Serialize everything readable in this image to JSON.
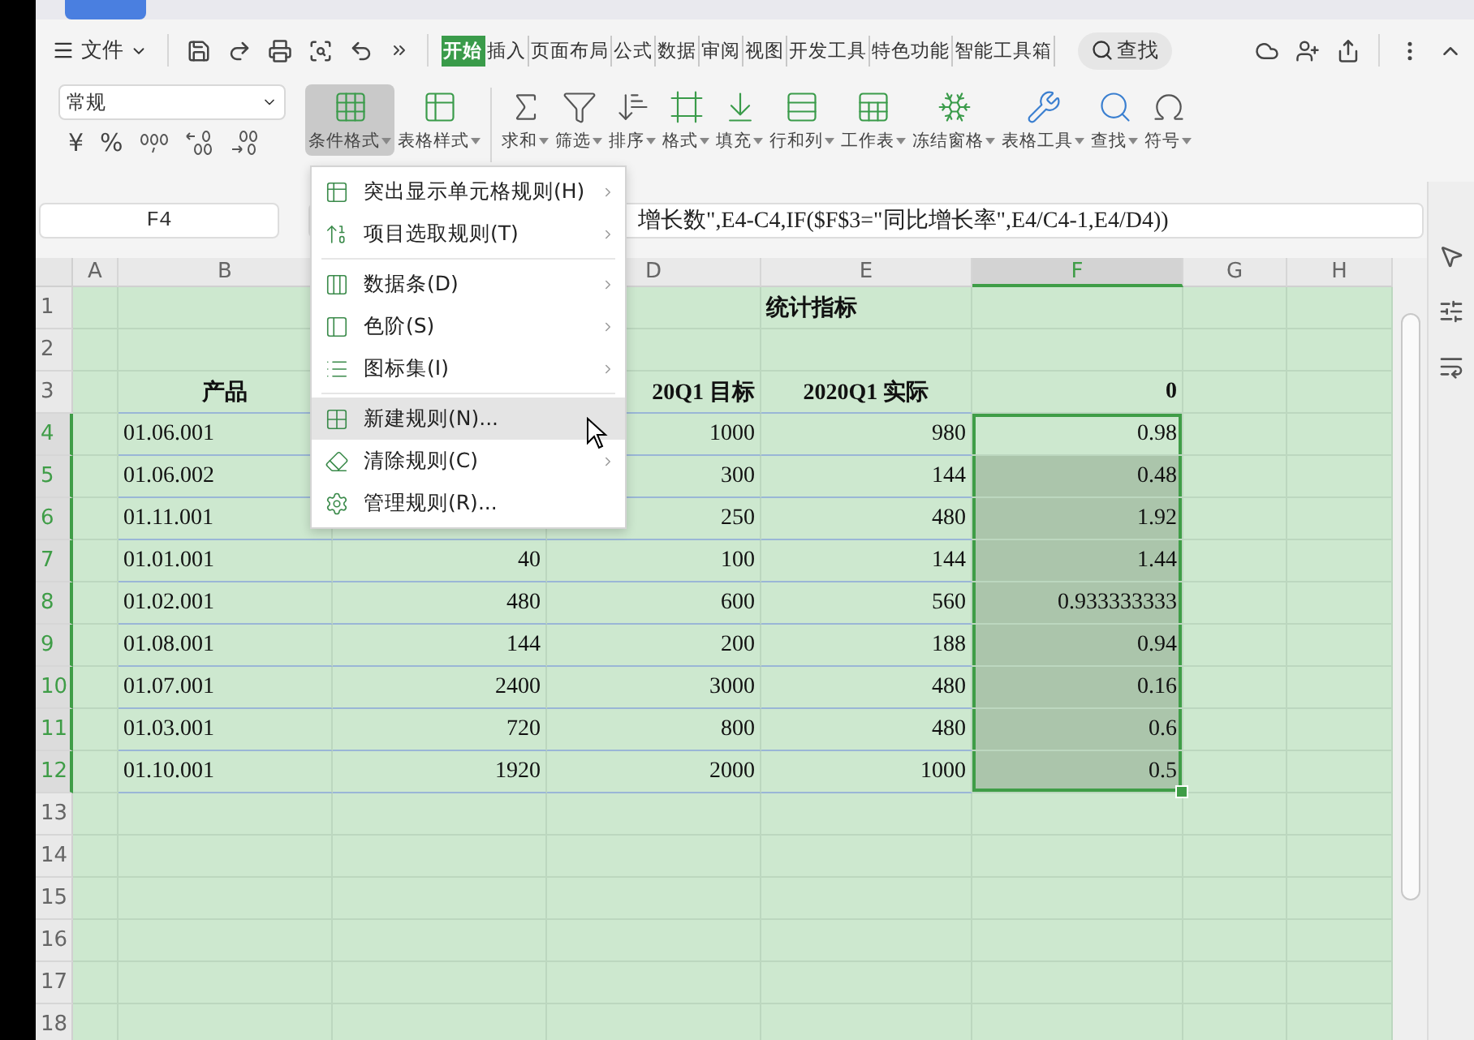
{
  "menu_bar": {
    "file_menu": "文件",
    "tabs": [
      {
        "label": "开始",
        "selected": true
      },
      {
        "label": "插入",
        "selected": false
      },
      {
        "label": "页面布局",
        "selected": false
      },
      {
        "label": "公式",
        "selected": false
      },
      {
        "label": "数据",
        "selected": false
      },
      {
        "label": "审阅",
        "selected": false
      },
      {
        "label": "视图",
        "selected": false
      },
      {
        "label": "开发工具",
        "selected": false
      },
      {
        "label": "特色功能",
        "selected": false
      },
      {
        "label": "智能工具箱",
        "selected": false
      }
    ],
    "search": "查找"
  },
  "ribbon": {
    "number_format": "常规",
    "number_buttons": [
      "¥",
      "%"
    ],
    "tools": [
      {
        "label": "条件格式",
        "pressed": true
      },
      {
        "label": "表格样式",
        "pressed": false
      },
      {
        "label": "求和",
        "pressed": false
      },
      {
        "label": "筛选",
        "pressed": false
      },
      {
        "label": "排序",
        "pressed": false
      },
      {
        "label": "格式",
        "pressed": false
      },
      {
        "label": "填充",
        "pressed": false
      },
      {
        "label": "行和列",
        "pressed": false
      },
      {
        "label": "工作表",
        "pressed": false
      },
      {
        "label": "冻结窗格",
        "pressed": false
      },
      {
        "label": "表格工具",
        "pressed": false
      },
      {
        "label": "查找",
        "pressed": false
      },
      {
        "label": "符号",
        "pressed": false
      }
    ]
  },
  "formula_bar": {
    "cell_ref": "F4",
    "formula": "增长数\",E4-C4,IF($F$3=\"同比增长率\",E4/C4-1,E4/D4))"
  },
  "context_menu": {
    "groups": [
      [
        {
          "label": "突出显示单元格规则(H)",
          "submenu": true,
          "hovered": false
        },
        {
          "label": "项目选取规则(T)",
          "submenu": true,
          "hovered": false
        }
      ],
      [
        {
          "label": "数据条(D)",
          "submenu": true,
          "hovered": false
        },
        {
          "label": "色阶(S)",
          "submenu": true,
          "hovered": false
        },
        {
          "label": "图标集(I)",
          "submenu": true,
          "hovered": false
        }
      ],
      [
        {
          "label": "新建规则(N)...",
          "submenu": false,
          "hovered": true
        },
        {
          "label": "清除规则(C)",
          "submenu": true,
          "hovered": false
        },
        {
          "label": "管理规则(R)...",
          "submenu": false,
          "hovered": false
        }
      ]
    ]
  },
  "sheet": {
    "columns": [
      {
        "label": "A",
        "selected": false
      },
      {
        "label": "B",
        "selected": false
      },
      {},
      {
        "label": "D",
        "selected": false
      },
      {
        "label": "E",
        "selected": false
      },
      {
        "label": "F",
        "selected": true
      },
      {
        "label": "G",
        "selected": false
      },
      {
        "label": "H",
        "selected": false
      }
    ],
    "rows": [
      {
        "number": "1",
        "kind": "title",
        "selected": false,
        "cells": [
          "",
          "",
          "",
          "",
          "统计指标",
          "",
          "",
          ""
        ]
      },
      {
        "number": "2",
        "kind": "blank",
        "selected": false,
        "cells": [
          "",
          "",
          "",
          "",
          "",
          "",
          "",
          ""
        ]
      },
      {
        "number": "3",
        "kind": "header",
        "selected": false,
        "cells": [
          "",
          "产品",
          "",
          "20Q1 目标",
          "2020Q1 实际",
          "0",
          "",
          ""
        ]
      },
      {
        "number": "4",
        "kind": "table",
        "selected": true,
        "cells": [
          "",
          "01.06.001",
          "",
          "1000",
          "980",
          "0.98",
          "",
          ""
        ]
      },
      {
        "number": "5",
        "kind": "table",
        "selected": true,
        "cells": [
          "",
          "01.06.002",
          "",
          "300",
          "144",
          "0.48",
          "",
          ""
        ]
      },
      {
        "number": "6",
        "kind": "table",
        "selected": true,
        "cells": [
          "",
          "01.11.001",
          "",
          "250",
          "480",
          "1.92",
          "",
          ""
        ]
      },
      {
        "number": "7",
        "kind": "table",
        "selected": true,
        "cells": [
          "",
          "01.01.001",
          "40",
          "100",
          "144",
          "1.44",
          "",
          ""
        ]
      },
      {
        "number": "8",
        "kind": "table",
        "selected": true,
        "cells": [
          "",
          "01.02.001",
          "480",
          "600",
          "560",
          "0.933333333",
          "",
          ""
        ]
      },
      {
        "number": "9",
        "kind": "table",
        "selected": true,
        "cells": [
          "",
          "01.08.001",
          "144",
          "200",
          "188",
          "0.94",
          "",
          ""
        ]
      },
      {
        "number": "10",
        "kind": "table",
        "selected": true,
        "cells": [
          "",
          "01.07.001",
          "2400",
          "3000",
          "480",
          "0.16",
          "",
          ""
        ]
      },
      {
        "number": "11",
        "kind": "table",
        "selected": true,
        "cells": [
          "",
          "01.03.001",
          "720",
          "800",
          "480",
          "0.6",
          "",
          ""
        ]
      },
      {
        "number": "12",
        "kind": "table",
        "selected": true,
        "cells": [
          "",
          "01.10.001",
          "1920",
          "2000",
          "1000",
          "0.5",
          "",
          ""
        ]
      },
      {
        "number": "13",
        "kind": "blank",
        "selected": false,
        "cells": [
          "",
          "",
          "",
          "",
          "",
          "",
          "",
          ""
        ]
      },
      {
        "number": "14",
        "kind": "blank",
        "selected": false,
        "cells": [
          "",
          "",
          "",
          "",
          "",
          "",
          "",
          ""
        ]
      },
      {
        "number": "15",
        "kind": "blank",
        "selected": false,
        "cells": [
          "",
          "",
          "",
          "",
          "",
          "",
          "",
          ""
        ]
      },
      {
        "number": "16",
        "kind": "blank",
        "selected": false,
        "cells": [
          "",
          "",
          "",
          "",
          "",
          "",
          "",
          ""
        ]
      },
      {
        "number": "17",
        "kind": "blank",
        "selected": false,
        "cells": [
          "",
          "",
          "",
          "",
          "",
          "",
          "",
          ""
        ]
      },
      {
        "number": "18",
        "kind": "blank",
        "selected": false,
        "cells": [
          "",
          "",
          "",
          "",
          "",
          "",
          "",
          ""
        ]
      }
    ]
  }
}
